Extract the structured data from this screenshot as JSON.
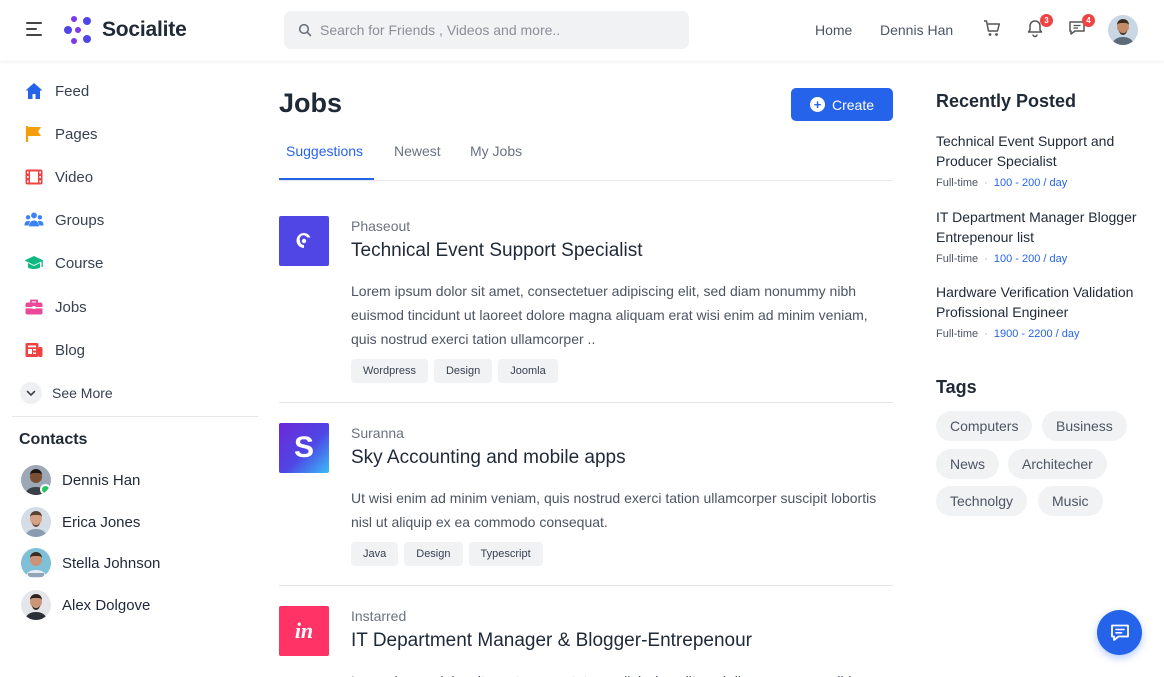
{
  "header": {
    "brand": "Socialite",
    "search_placeholder": "Search for Friends , Videos and more..",
    "nav": [
      "Home",
      "Dennis Han"
    ],
    "notifications_count": "3",
    "messages_count": "4"
  },
  "sidebar": {
    "items": [
      {
        "label": "Feed",
        "icon": "home-icon",
        "color": "#2563eb"
      },
      {
        "label": "Pages",
        "icon": "flag-icon",
        "color": "#f59e0b"
      },
      {
        "label": "Video",
        "icon": "film-icon",
        "color": "#ef4444"
      },
      {
        "label": "Groups",
        "icon": "users-icon",
        "color": "#3b82f6"
      },
      {
        "label": "Course",
        "icon": "graduation-cap-icon",
        "color": "#10b981"
      },
      {
        "label": "Jobs",
        "icon": "briefcase-icon",
        "color": "#ec4899"
      },
      {
        "label": "Blog",
        "icon": "newspaper-icon",
        "color": "#ef4444"
      }
    ],
    "see_more": "See More",
    "contacts_title": "Contacts",
    "contacts": [
      {
        "name": "Dennis Han",
        "online": true
      },
      {
        "name": "Erica Jones",
        "online": false
      },
      {
        "name": "Stella Johnson",
        "online": false
      },
      {
        "name": "Alex Dolgove",
        "online": false
      }
    ]
  },
  "main": {
    "title": "Jobs",
    "create_label": "Create",
    "tabs": [
      {
        "label": "Suggestions",
        "active": true
      },
      {
        "label": "Newest",
        "active": false
      },
      {
        "label": "My Jobs",
        "active": false
      }
    ],
    "jobs": [
      {
        "company": "Phaseout",
        "title": "Technical Event Support Specialist",
        "description": "Lorem ipsum dolor sit amet, consectetuer adipiscing elit, sed diam nonummy nibh euismod tincidunt ut laoreet dolore magna aliquam erat wisi enim ad minim veniam, quis nostrud exerci tation ullamcorper ..",
        "tags": [
          "Wordpress",
          "Design",
          "Joomla"
        ],
        "logo_color": "#4f46e5"
      },
      {
        "company": "Suranna",
        "title": "Sky Accounting and mobile apps",
        "description": "Ut wisi enim ad minim veniam, quis nostrud exerci tation ullamcorper suscipit lobortis nisl ut aliquip ex ea commodo consequat.",
        "tags": [
          "Java",
          "Design",
          "Typescript"
        ],
        "logo_color": "#6d28d9",
        "logo_letter": "S"
      },
      {
        "company": "Instarred",
        "title": "IT Department Manager & Blogger-Entrepenour",
        "description": "Lorem ipsum dolor sit amet, consectetuer adipiscing elit, sed diam nonummy nibh",
        "tags": [],
        "logo_color": "#ff3366",
        "logo_letter": "in"
      }
    ]
  },
  "right": {
    "recent_title": "Recently Posted",
    "recent": [
      {
        "title": "Technical Event Support and Producer Specialist",
        "type": "Full-time",
        "pay": "100 - 200 / day"
      },
      {
        "title": "IT Department Manager Blogger Entrepenour list",
        "type": "Full-time",
        "pay": "100 - 200 / day"
      },
      {
        "title": "Hardware Verification Validation Profissional Engineer",
        "type": "Full-time",
        "pay": "1900 - 2200 / day"
      }
    ],
    "tags_title": "Tags",
    "tags": [
      "Computers",
      "Business",
      "News",
      "Architecher",
      "Technolgy",
      "Music"
    ]
  },
  "colors": {
    "accent": "#2563eb",
    "badge": "#ef4444",
    "online": "#22c55e"
  }
}
